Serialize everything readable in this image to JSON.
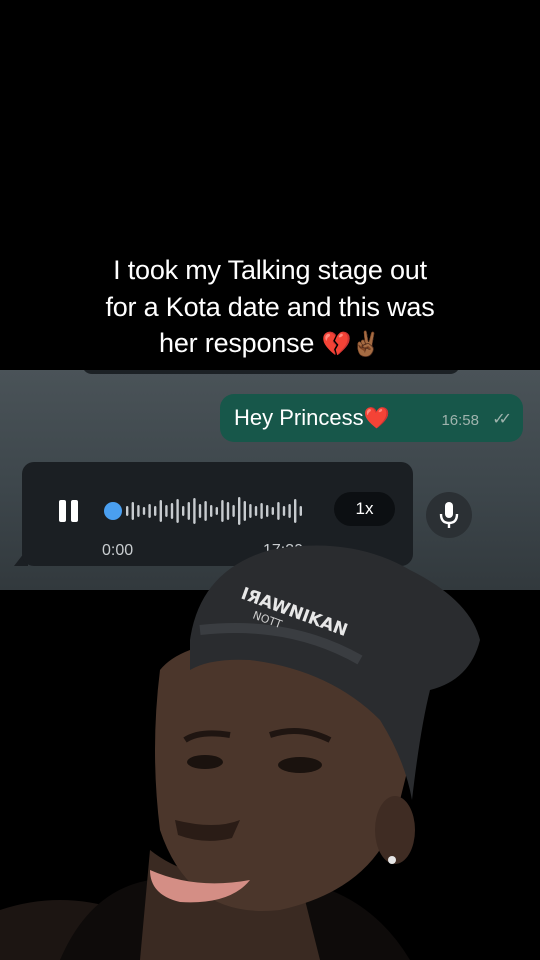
{
  "caption": {
    "line1": "I took my Talking stage out",
    "line2": "for a Kota date and this was",
    "line3": "her response",
    "emoji1": "💔",
    "emoji2": "✌🏾"
  },
  "chat": {
    "outgoing": {
      "text": "Hey Princess",
      "emoji": "❤️",
      "time": "16:58",
      "status": "✓✓"
    },
    "voice_note": {
      "current_time": "0:00",
      "duration": "17:30",
      "speed": "1x",
      "playing": true,
      "progress": 0
    }
  },
  "icons": {
    "pause": "pause-icon",
    "mic": "mic-icon",
    "ticks": "double-check-icon"
  },
  "colors": {
    "outgoing_bubble": "#17574a",
    "incoming_bubble": "#1b1f23",
    "accent_blue": "#4a9ff0",
    "background": "#000000"
  }
}
